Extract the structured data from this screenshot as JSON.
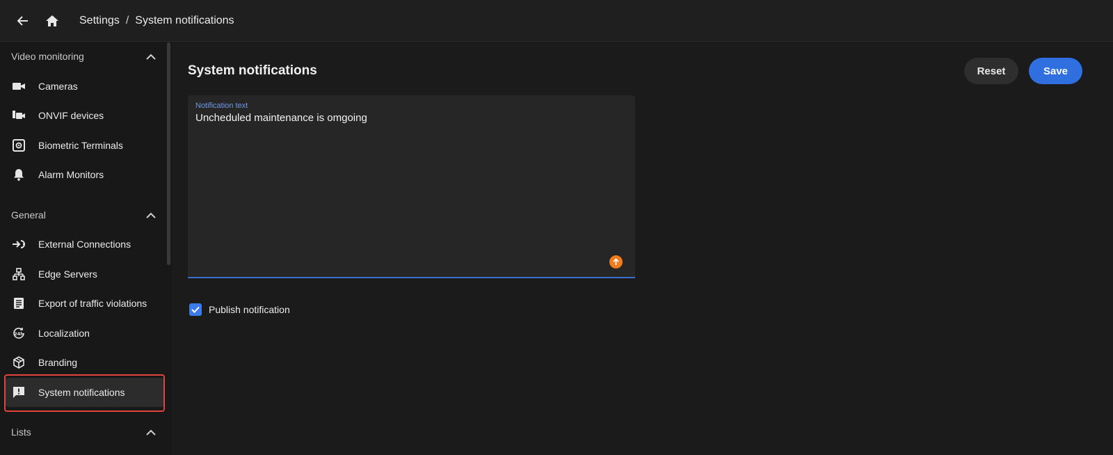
{
  "breadcrumb": {
    "root": "Settings",
    "separator": "/",
    "current": "System notifications"
  },
  "sidebar": {
    "sections": [
      {
        "label": "Video monitoring"
      },
      {
        "label": "General"
      },
      {
        "label": "Lists"
      }
    ],
    "items": [
      {
        "label": "Cameras",
        "icon": "video-camera-icon"
      },
      {
        "label": "ONVIF devices",
        "icon": "onvif-device-icon"
      },
      {
        "label": "Biometric Terminals",
        "icon": "biometric-terminal-icon"
      },
      {
        "label": "Alarm Monitors",
        "icon": "bell-icon"
      },
      {
        "label": "External Connections",
        "icon": "external-connection-icon"
      },
      {
        "label": "Edge Servers",
        "icon": "edge-server-icon"
      },
      {
        "label": "Export of traffic violations",
        "icon": "document-list-icon"
      },
      {
        "label": "Localization",
        "icon": "clock-24h-icon"
      },
      {
        "label": "Branding",
        "icon": "cube-icon"
      },
      {
        "label": "System notifications",
        "icon": "alert-message-icon"
      }
    ]
  },
  "main": {
    "title": "System notifications",
    "reset_label": "Reset",
    "save_label": "Save",
    "notification_field": {
      "label": "Notification text",
      "value": "Uncheduled maintenance is omgoing"
    },
    "publish_label": "Publish notification",
    "publish_checked": true
  },
  "colors": {
    "accent": "#2f6fe0",
    "highlight": "#e0443a",
    "warning": "#f07c1e"
  }
}
